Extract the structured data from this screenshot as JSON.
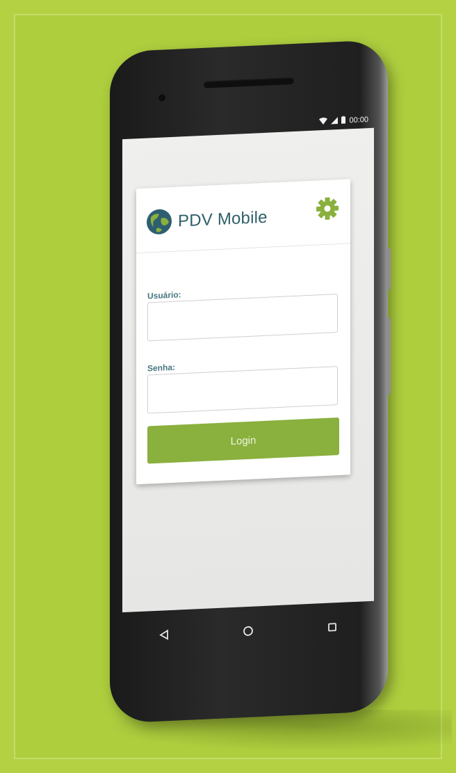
{
  "status_bar": {
    "time": "00:00",
    "wifi_icon": "wifi-icon",
    "signal_icon": "signal-icon",
    "battery_icon": "battery-icon"
  },
  "app": {
    "title": "PDV Mobile",
    "logo_icon": "globe-icon",
    "settings_icon": "gear-icon"
  },
  "login_form": {
    "username_label": "Usuário:",
    "username_value": "",
    "password_label": "Senha:",
    "password_value": "",
    "login_label": "Login"
  },
  "nav_bar": {
    "back_icon": "back-triangle-icon",
    "home_icon": "home-circle-icon",
    "recents_icon": "recents-square-icon"
  },
  "colors": {
    "background": "#b4d143",
    "accent": "#8ab03e",
    "title_text": "#2f5f6a",
    "label_text": "#46777f"
  }
}
